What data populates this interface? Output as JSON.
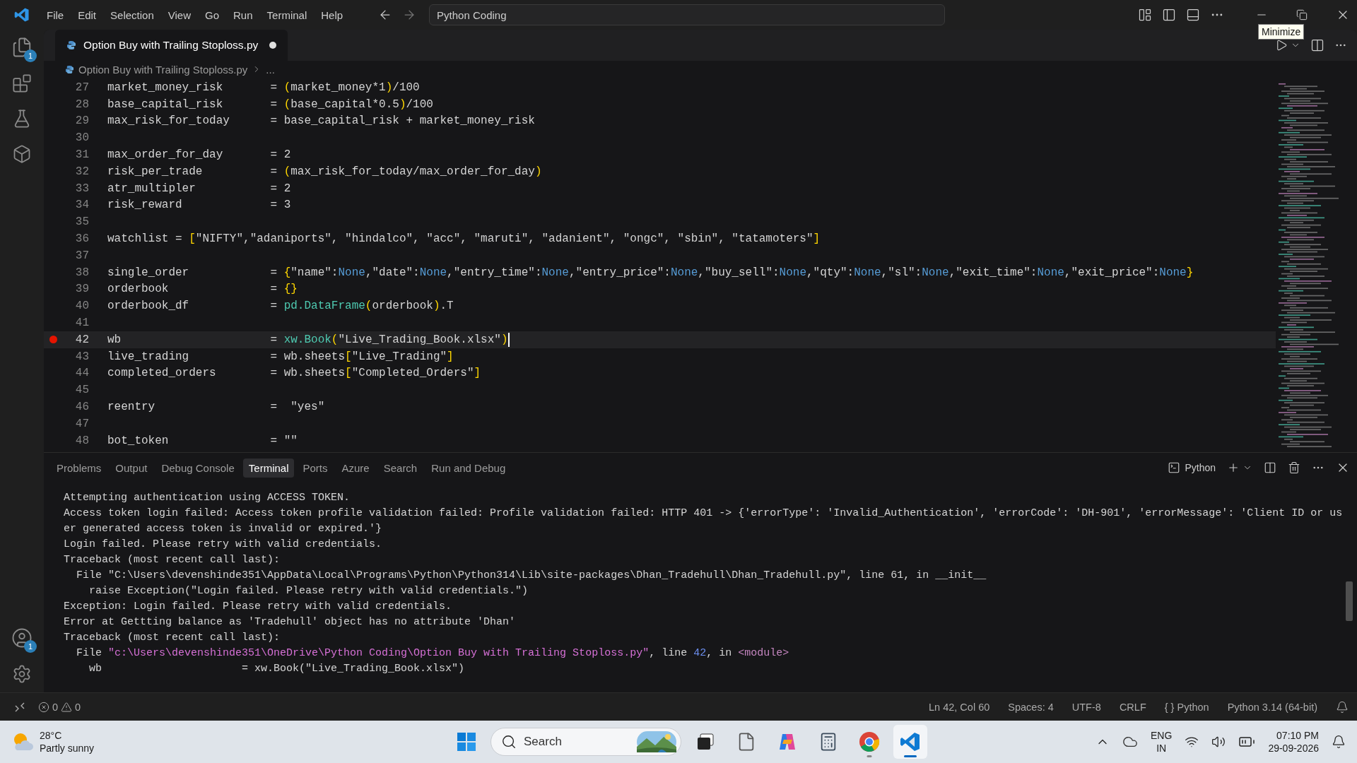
{
  "title_bar": {
    "menu": [
      "File",
      "Edit",
      "Selection",
      "View",
      "Go",
      "Run",
      "Terminal",
      "Help"
    ],
    "command_center": "Python Coding",
    "tooltip": "Minimize"
  },
  "activity_bar": {
    "explorer_badge": "1",
    "account_badge": "1"
  },
  "editor_tab": {
    "label": "Option Buy with Trailing Stoploss.py",
    "selected": true,
    "modified": true
  },
  "breadcrumb": {
    "file": "Option Buy with Trailing Stoploss.py",
    "more": "..."
  },
  "code_lines": [
    {
      "number": "27",
      "breakpoint": false,
      "current": false,
      "segments": [
        {
          "kind": "plain",
          "text": "market_money_risk       = "
        },
        {
          "kind": "bracket",
          "text": "("
        },
        {
          "kind": "plain",
          "text": "market_money*1"
        },
        {
          "kind": "bracket",
          "text": ")"
        },
        {
          "kind": "plain",
          "text": "/100"
        }
      ]
    },
    {
      "number": "28",
      "breakpoint": false,
      "current": false,
      "segments": [
        {
          "kind": "plain",
          "text": "base_capital_risk       = "
        },
        {
          "kind": "bracket",
          "text": "("
        },
        {
          "kind": "plain",
          "text": "base_capital*0.5"
        },
        {
          "kind": "bracket",
          "text": ")"
        },
        {
          "kind": "plain",
          "text": "/100"
        }
      ]
    },
    {
      "number": "29",
      "breakpoint": false,
      "current": false,
      "segments": [
        {
          "kind": "plain",
          "text": "max_risk_for_today      = base_capital_risk + market_money_risk"
        }
      ]
    },
    {
      "number": "30",
      "breakpoint": false,
      "current": false
    },
    {
      "number": "31",
      "breakpoint": false,
      "current": false,
      "segments": [
        {
          "kind": "plain",
          "text": "max_order_for_day       = 2"
        }
      ]
    },
    {
      "number": "32",
      "breakpoint": false,
      "current": false,
      "segments": [
        {
          "kind": "plain",
          "text": "risk_per_trade          = "
        },
        {
          "kind": "bracket",
          "text": "("
        },
        {
          "kind": "plain",
          "text": "max_risk_for_today/max_order_for_day"
        },
        {
          "kind": "bracket",
          "text": ")"
        }
      ]
    },
    {
      "number": "33",
      "breakpoint": false,
      "current": false,
      "segments": [
        {
          "kind": "plain",
          "text": "atr_multipler           = 2"
        }
      ]
    },
    {
      "number": "34",
      "breakpoint": false,
      "current": false,
      "segments": [
        {
          "kind": "plain",
          "text": "risk_reward             = 3"
        }
      ]
    },
    {
      "number": "35",
      "breakpoint": false,
      "current": false
    },
    {
      "number": "36",
      "breakpoint": false,
      "current": false,
      "segments": [
        {
          "kind": "plain",
          "text": "watchlist = "
        },
        {
          "kind": "bracket",
          "text": "["
        },
        {
          "kind": "plain",
          "text": "\"NIFTY\",\"adaniports\", \"hindalco\", \"acc\", \"maruti\", \"adanient\", \"ongc\", \"sbin\", \"tatamoters\""
        },
        {
          "kind": "bracket",
          "text": "]"
        }
      ]
    },
    {
      "number": "37",
      "breakpoint": false,
      "current": false
    },
    {
      "number": "38",
      "breakpoint": false,
      "current": false,
      "segments": [
        {
          "kind": "plain",
          "text": "single_order            = "
        },
        {
          "kind": "bracket",
          "text": "{"
        },
        {
          "kind": "plain",
          "text": "\"name\":"
        },
        {
          "kind": "keyword",
          "text": "None"
        },
        {
          "kind": "plain",
          "text": ",\"date\":"
        },
        {
          "kind": "keyword",
          "text": "None"
        },
        {
          "kind": "plain",
          "text": ",\"entry_time\":"
        },
        {
          "kind": "keyword",
          "text": "None"
        },
        {
          "kind": "plain",
          "text": ",\"entry_price\":"
        },
        {
          "kind": "keyword",
          "text": "None"
        },
        {
          "kind": "plain",
          "text": ",\"buy_sell\":"
        },
        {
          "kind": "keyword",
          "text": "None"
        },
        {
          "kind": "plain",
          "text": ",\"qty\":"
        },
        {
          "kind": "keyword",
          "text": "None"
        },
        {
          "kind": "plain",
          "text": ",\"sl\":"
        },
        {
          "kind": "keyword",
          "text": "None"
        },
        {
          "kind": "plain",
          "text": ",\"exit_time\":"
        },
        {
          "kind": "keyword",
          "text": "None"
        },
        {
          "kind": "plain",
          "text": ",\"exit_price\":"
        },
        {
          "kind": "keyword",
          "text": "None"
        },
        {
          "kind": "bracket",
          "text": "}"
        }
      ]
    },
    {
      "number": "39",
      "breakpoint": false,
      "current": false,
      "segments": [
        {
          "kind": "plain",
          "text": "orderbook               = "
        },
        {
          "kind": "bracket",
          "text": "{}"
        }
      ]
    },
    {
      "number": "40",
      "breakpoint": false,
      "current": false,
      "segments": [
        {
          "kind": "plain",
          "text": "orderbook_df            = "
        },
        {
          "kind": "type",
          "text": "pd.DataFrame"
        },
        {
          "kind": "bracket",
          "text": "("
        },
        {
          "kind": "plain",
          "text": "orderbook"
        },
        {
          "kind": "bracket",
          "text": ")"
        },
        {
          "kind": "plain",
          "text": ".T"
        }
      ]
    },
    {
      "number": "41",
      "breakpoint": false,
      "current": false
    },
    {
      "number": "42",
      "breakpoint": true,
      "current": true,
      "segments": [
        {
          "kind": "plain",
          "text": "wb                      = "
        },
        {
          "kind": "type",
          "text": "xw.Book"
        },
        {
          "kind": "bracket",
          "text": "("
        },
        {
          "kind": "plain",
          "text": "\"Live_Trading_Book.xlsx\""
        },
        {
          "kind": "bracket",
          "text": ")"
        }
      ]
    },
    {
      "number": "43",
      "breakpoint": false,
      "current": false,
      "segments": [
        {
          "kind": "plain",
          "text": "live_trading            = wb.sheets"
        },
        {
          "kind": "bracket",
          "text": "["
        },
        {
          "kind": "plain",
          "text": "\"Live_Trading\""
        },
        {
          "kind": "bracket",
          "text": "]"
        }
      ]
    },
    {
      "number": "44",
      "breakpoint": false,
      "current": false,
      "segments": [
        {
          "kind": "plain",
          "text": "completed_orders        = wb.sheets"
        },
        {
          "kind": "bracket",
          "text": "["
        },
        {
          "kind": "plain",
          "text": "\"Completed_Orders\""
        },
        {
          "kind": "bracket",
          "text": "]"
        }
      ]
    },
    {
      "number": "45",
      "breakpoint": false,
      "current": false
    },
    {
      "number": "46",
      "breakpoint": false,
      "current": false,
      "segments": [
        {
          "kind": "plain",
          "text": "reentry                 =  \"yes\""
        }
      ]
    },
    {
      "number": "47",
      "breakpoint": false,
      "current": false
    },
    {
      "number": "48",
      "breakpoint": false,
      "current": false,
      "segments": [
        {
          "kind": "plain",
          "text": "bot_token               = \"\""
        }
      ]
    }
  ],
  "panel": {
    "tabs": [
      {
        "label": "Problems",
        "selected": false
      },
      {
        "label": "Output",
        "selected": false
      },
      {
        "label": "Debug Console",
        "selected": false
      },
      {
        "label": "Terminal",
        "selected": true
      },
      {
        "label": "Ports",
        "selected": false
      },
      {
        "label": "Azure",
        "selected": false
      },
      {
        "label": "Search",
        "selected": false
      },
      {
        "label": "Run and Debug",
        "selected": false
      }
    ],
    "terminal_name": "Python",
    "lines": [
      [
        {
          "kind": "plain",
          "text": "Attempting authentication using ACCESS TOKEN."
        }
      ],
      [
        {
          "kind": "plain",
          "text": "Access token login failed: Access token profile validation failed: Profile validation failed: HTTP 401 -> {'errorType': 'Invalid_Authentication', 'errorCode': 'DH-901', 'errorMessage': 'Client ID or us"
        }
      ],
      [
        {
          "kind": "plain",
          "text": "er generated access token is invalid or expired.'}"
        }
      ],
      [
        {
          "kind": "plain",
          "text": "Login failed. Please retry with valid credentials."
        }
      ],
      [
        {
          "kind": "plain",
          "text": "Traceback (most recent call last):"
        }
      ],
      [
        {
          "kind": "plain",
          "text": "  File \"C:\\Users\\devenshinde351\\AppData\\Local\\Programs\\Python\\Python314\\Lib\\site-packages\\Dhan_Tradehull\\Dhan_Tradehull.py\", line 61, in __init__"
        }
      ],
      [
        {
          "kind": "plain",
          "text": "    raise Exception(\"Login failed. Please retry with valid credentials.\")"
        }
      ],
      [
        {
          "kind": "plain",
          "text": "Exception: Login failed. Please retry with valid credentials."
        }
      ],
      [
        {
          "kind": "plain",
          "text": "Error at Gettting balance as 'Tradehull' object has no attribute 'Dhan'"
        }
      ],
      [
        {
          "kind": "plain",
          "text": "Traceback (most recent call last):"
        }
      ],
      [
        {
          "kind": "plain",
          "text": "  File "
        },
        {
          "kind": "path",
          "text": "\"c:\\Users\\devenshinde351\\OneDrive\\Python Coding\\Option Buy with Trailing Stoploss.py\""
        },
        {
          "kind": "plain",
          "text": ", line "
        },
        {
          "kind": "number",
          "text": "42"
        },
        {
          "kind": "plain",
          "text": ", in "
        },
        {
          "kind": "module",
          "text": "<module>"
        }
      ],
      [
        {
          "kind": "plain",
          "text": "    wb                      = xw.Book(\"Live_Trading_Book.xlsx\")"
        }
      ]
    ]
  },
  "status_bar": {
    "errors": "0",
    "warnings": "0",
    "items": [
      "Ln 42, Col 60",
      "Spaces: 4",
      "UTF-8",
      "CRLF",
      "{ } Python",
      "Python 3.14 (64-bit)"
    ]
  },
  "taskbar": {
    "temperature": "28°C",
    "condition": "Partly sunny",
    "search": "Search",
    "apps": [
      {
        "kind": "windows",
        "selected": false
      },
      {
        "kind": "taskview",
        "selected": false
      },
      {
        "kind": "file",
        "selected": false
      },
      {
        "kind": "copilot",
        "selected": false
      },
      {
        "kind": "calculator",
        "selected": false
      },
      {
        "kind": "chrome",
        "selected": false,
        "running": true
      },
      {
        "kind": "vscode",
        "selected": true,
        "running": true
      }
    ],
    "language": "ENG",
    "region": "IN",
    "time": "07:10 PM",
    "date": "29-09-2026"
  }
}
